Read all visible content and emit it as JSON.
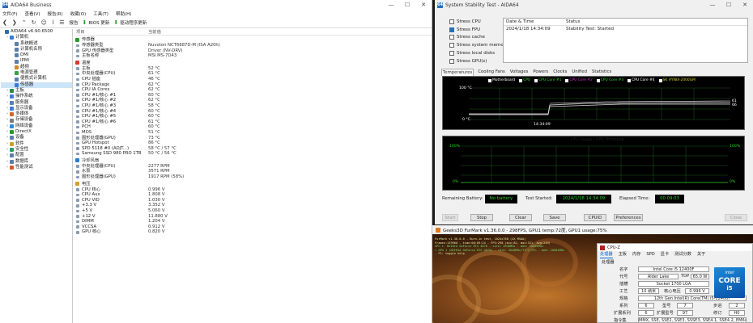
{
  "aida": {
    "title": "AIDA64 Business",
    "controls": [
      "—",
      "☐",
      "✕"
    ],
    "menu": [
      "文件(F)",
      "查看(V)",
      "报告(R)",
      "收藏(O)",
      "工具(T)",
      "帮助(H)"
    ],
    "toolbar": {
      "report": "报告",
      "bios": "BIOS 更新",
      "driver": "驱动程序更新"
    },
    "tree": [
      {
        "label": "AIDA64 v6.90.6500",
        "indent": 0,
        "color": "#2a6fb7"
      },
      {
        "label": "计算机",
        "indent": 1,
        "color": "#3a7bd5"
      },
      {
        "label": "系统概述",
        "indent": 2,
        "color": "#5b7fa8"
      },
      {
        "label": "计算机名称",
        "indent": 2,
        "color": "#5b7fa8"
      },
      {
        "label": "DMI",
        "indent": 2,
        "color": "#5b7fa8"
      },
      {
        "label": "IPMI",
        "indent": 2,
        "color": "#5b7fa8"
      },
      {
        "label": "超频",
        "indent": 2,
        "color": "#d08a2a"
      },
      {
        "label": "电源管理",
        "indent": 2,
        "color": "#3aa04a"
      },
      {
        "label": "便携式计算机",
        "indent": 2,
        "color": "#5b7fa8"
      },
      {
        "label": "传感器",
        "indent": 2,
        "color": "#3a7bd5",
        "selected": true
      },
      {
        "label": "主板",
        "indent": 1,
        "color": "#2a8a4a"
      },
      {
        "label": "操作系统",
        "indent": 1,
        "color": "#3a7bd5"
      },
      {
        "label": "服务器",
        "indent": 1,
        "color": "#5b7fa8"
      },
      {
        "label": "显示设备",
        "indent": 1,
        "color": "#3a7bd5"
      },
      {
        "label": "多媒体",
        "indent": 1,
        "color": "#d06a2a"
      },
      {
        "label": "存储设备",
        "indent": 1,
        "color": "#7a7a7a"
      },
      {
        "label": "网络设备",
        "indent": 1,
        "color": "#2a8ad5"
      },
      {
        "label": "DirectX",
        "indent": 1,
        "color": "#2a9a2a"
      },
      {
        "label": "设备",
        "indent": 1,
        "color": "#5b7fa8"
      },
      {
        "label": "软件",
        "indent": 1,
        "color": "#c8a02a"
      },
      {
        "label": "安全性",
        "indent": 1,
        "color": "#2a9a6a"
      },
      {
        "label": "配置",
        "indent": 1,
        "color": "#5b7fa8"
      },
      {
        "label": "数据库",
        "indent": 1,
        "color": "#5b7fa8"
      },
      {
        "label": "性能测试",
        "indent": 1,
        "color": "#d05a2a"
      }
    ],
    "columns": {
      "field": "项目",
      "value": "当前值"
    },
    "sections": [
      {
        "title": "传感器",
        "color": "#2a9a2a",
        "rows": [
          {
            "f": "传感器类型",
            "v": "Nuvoton NCT6687D-M  (ISA A20h)"
          },
          {
            "f": "GPU 传感器类型",
            "v": "Driver  (NV-DRV)"
          },
          {
            "f": "主板名称",
            "v": "MSI MS-7D43"
          }
        ]
      },
      {
        "title": "温度",
        "color": "#d03a2a",
        "rows": [
          {
            "f": "主板",
            "v": "52 °C"
          },
          {
            "f": "中央处理器(CPU)",
            "v": "61 °C"
          },
          {
            "f": "CPU 插座",
            "v": "46 °C"
          },
          {
            "f": "CPU Package",
            "v": "62 °C"
          },
          {
            "f": "CPU IA Cores",
            "v": "62 °C"
          },
          {
            "f": "CPU #1/核心 #1",
            "v": "60 °C"
          },
          {
            "f": "CPU #1/核心 #2",
            "v": "62 °C"
          },
          {
            "f": "CPU #1/核心 #3",
            "v": "58 °C"
          },
          {
            "f": "CPU #1/核心 #4",
            "v": "60 °C"
          },
          {
            "f": "CPU #1/核心 #5",
            "v": "60 °C"
          },
          {
            "f": "CPU #1/核心 #6",
            "v": "61 °C"
          },
          {
            "f": "PCH",
            "v": "60 °C"
          },
          {
            "f": "MOS",
            "v": "51 °C"
          },
          {
            "f": "图形处理器(GPU)",
            "v": "73 °C"
          },
          {
            "f": "GPU Hotspot",
            "v": "86 °C"
          },
          {
            "f": "SPD 5118 #0 (ADJT...)",
            "v": "58 °C / 57 °C"
          },
          {
            "f": "Samsung SSD 980 PRO 1TB",
            "v": "50 °C / 56 °C"
          }
        ]
      },
      {
        "title": "冷却风扇",
        "color": "#2a7ad5",
        "rows": [
          {
            "f": "中央处理器(CPU)",
            "v": "2277 RPM"
          },
          {
            "f": "水泵",
            "v": "3571 RPM"
          },
          {
            "f": "图形处理器(GPU)",
            "v": "1917 RPM  (58%)"
          }
        ]
      },
      {
        "title": "电压",
        "color": "#d0a02a",
        "rows": [
          {
            "f": "CPU 核心",
            "v": "0.996 V"
          },
          {
            "f": "CPU Aux",
            "v": "1.808 V"
          },
          {
            "f": "CPU VID",
            "v": "1.030 V"
          },
          {
            "f": "+3.3 V",
            "v": "3.352 V"
          },
          {
            "f": "+5 V",
            "v": "5.060 V"
          },
          {
            "f": "+12 V",
            "v": "11.880 V"
          },
          {
            "f": "DIMM",
            "v": "1.204 V"
          },
          {
            "f": "VCCSA",
            "v": "0.912 V"
          },
          {
            "f": "GPU 核心",
            "v": "0.820 V"
          }
        ]
      }
    ]
  },
  "sst": {
    "title": "System Stability Test - AIDA64",
    "checks": [
      {
        "label": "Stress CPU",
        "on": false
      },
      {
        "label": "Stress FPU",
        "on": true
      },
      {
        "label": "Stress cache",
        "on": false
      },
      {
        "label": "Stress system memory",
        "on": false
      },
      {
        "label": "Stress local disks",
        "on": false
      },
      {
        "label": "Stress GPU(s)",
        "on": false
      }
    ],
    "log": {
      "h1": "Date & Time",
      "h2": "Status",
      "d": "2024/1/18 14:34:09",
      "s": "Stability Test: Started"
    },
    "tabs": [
      "Temperatures",
      "Cooling Fans",
      "Voltages",
      "Powers",
      "Clocks",
      "Unified",
      "Statistics"
    ],
    "legend": [
      "Motherboard",
      "CPU",
      "CPU Core #1",
      "CPU Core #2",
      "CPU Core #3",
      "CPU Core #4",
      "SK HYNIX-2000GM"
    ],
    "graph1": {
      "top": "100 °C",
      "bottom": "0 °C",
      "time": "14:34:09",
      "right_a": "61",
      "right_b": "66"
    },
    "graph2": {
      "title": "CPU Usage | CPU Throttling",
      "top_l": "100%",
      "bot_l": "0%",
      "top_r": "100%",
      "bot_r": "0%"
    },
    "status": {
      "battery_label": "Remaining Battery:",
      "battery": "No battery",
      "started_label": "Test Started:",
      "started": "2024/1/18 14:34:09",
      "elapsed_label": "Elapsed Time:",
      "elapsed": "00:09:03"
    },
    "buttons": [
      "Start",
      "Stop",
      "Clear",
      "Save",
      "CPUID",
      "Preferences",
      "Close"
    ]
  },
  "fur": {
    "title": "Geeks3D FurMark v1.36.0.0 - 298FPS, GPU1 temp:72度, GPU1 usage:75%",
    "osd": [
      "FurMark v1.36.0.0 - Burn-in test, 1024x768 (4X MSAA)",
      "Frames:139960 - time:00:09:24 - FPS:298 (min:82, max:321, avg:249)",
      "GPU 1: NVIDIA GeForce RTX 4070 - core: 2640MHz - mem: 10501MHz",
      "> GPU 1 (NVIDIA GeForce RTX 4070) - core: 2640MHz/73°C/75% - mem: 10501MHz",
      "- F1: toggle help"
    ]
  },
  "cpuz": {
    "title": "CPU-Z",
    "tabs": [
      "处理器",
      "主板",
      "内存",
      "SPD",
      "显卡",
      "测试分数",
      "关于"
    ],
    "group": "处理器",
    "name_l": "名字",
    "name": "Intel Core i5 12400F",
    "code_l": "代号",
    "code": "Alder Lake",
    "tdp_l": "TDP",
    "tdp": "65.0 W",
    "pkg_l": "插槽",
    "pkg": "Socket 1700 LGA",
    "tech_l": "工艺",
    "tech": "10 纳米",
    "volt_l": "核心电压",
    "volt": "0.996 V",
    "spec_l": "规格",
    "spec": "12th Gen Intel(R) Core(TM) i5-12400F",
    "fam_l": "系列",
    "fam": "6",
    "model_l": "型号",
    "model": "7",
    "step_l": "步进",
    "step": "2",
    "efam_l": "扩展系列",
    "efam": "6",
    "emod_l": "扩展型号",
    "emod": "97",
    "rev_l": "修订",
    "rev": "H0",
    "inst_l": "指令集",
    "inst": "MMX, SSE, SSE2, SSE3, SSSE3, SSE4.1, SSE4.2, EM64T, VT-x",
    "logo_top": "intel",
    "logo_mid": "CORE",
    "logo_bot": "i5"
  }
}
